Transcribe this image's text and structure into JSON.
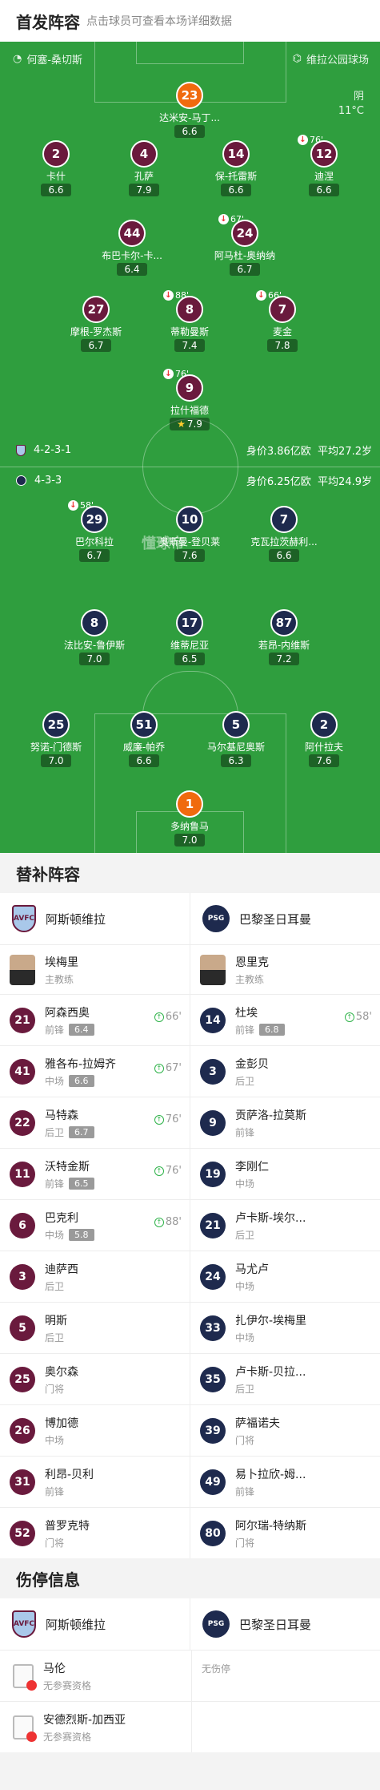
{
  "header": {
    "title": "首发阵容",
    "hint": "点击球员可查看本场详细数据"
  },
  "pitch_top": {
    "referee": "何塞-桑切斯",
    "stadium": "维拉公园球场",
    "weather": "阴",
    "temperature": "11°C",
    "watermark": "懂球帝"
  },
  "home": {
    "formation": "4-2-3-1",
    "value": "身价3.86亿欧",
    "age": "平均27.2岁"
  },
  "away": {
    "formation": "4-3-3",
    "value": "身价6.25亿欧",
    "age": "平均24.9岁"
  },
  "home_players": [
    {
      "num": "23",
      "name": "达米安-马丁...",
      "rating": "6.6",
      "gk": true
    },
    {
      "num": "2",
      "name": "卡什",
      "rating": "6.6"
    },
    {
      "num": "4",
      "name": "孔萨",
      "rating": "7.9"
    },
    {
      "num": "14",
      "name": "保-托雷斯",
      "rating": "6.6"
    },
    {
      "num": "12",
      "name": "迪涅",
      "rating": "6.6",
      "sub": "76'"
    },
    {
      "num": "44",
      "name": "布巴卡尔-卡...",
      "rating": "6.4"
    },
    {
      "num": "24",
      "name": "阿马杜-奥纳纳",
      "rating": "6.7",
      "sub": "67'"
    },
    {
      "num": "27",
      "name": "摩根-罗杰斯",
      "rating": "6.7"
    },
    {
      "num": "8",
      "name": "蒂勒曼斯",
      "rating": "7.4",
      "sub": "88'"
    },
    {
      "num": "7",
      "name": "麦金",
      "rating": "7.8",
      "sub": "66'"
    },
    {
      "num": "9",
      "name": "拉什福德",
      "rating": "7.9",
      "sub": "76'",
      "star": true
    }
  ],
  "away_players": [
    {
      "num": "29",
      "name": "巴尔科拉",
      "rating": "6.7",
      "sub": "58'"
    },
    {
      "num": "10",
      "name": "奥斯曼-登贝莱",
      "rating": "7.6"
    },
    {
      "num": "7",
      "name": "克瓦拉茨赫利...",
      "rating": "6.6"
    },
    {
      "num": "8",
      "name": "法比安-鲁伊斯",
      "rating": "7.0"
    },
    {
      "num": "17",
      "name": "维蒂尼亚",
      "rating": "6.5"
    },
    {
      "num": "87",
      "name": "若昂-内维斯",
      "rating": "7.2"
    },
    {
      "num": "25",
      "name": "努诺-门德斯",
      "rating": "7.0"
    },
    {
      "num": "51",
      "name": "威廉-帕乔",
      "rating": "6.6"
    },
    {
      "num": "5",
      "name": "马尔基尼奥斯",
      "rating": "6.3"
    },
    {
      "num": "2",
      "name": "阿什拉夫",
      "rating": "7.6"
    },
    {
      "num": "1",
      "name": "多纳鲁马",
      "rating": "7.0",
      "gk": true
    }
  ],
  "subs": {
    "title": "替补阵容",
    "home_team": "阿斯顿维拉",
    "away_team": "巴黎圣日耳曼",
    "home_coach": {
      "name": "埃梅里",
      "role": "主教练"
    },
    "away_coach": {
      "name": "恩里克",
      "role": "主教练"
    },
    "rows": [
      [
        {
          "num": "21",
          "name": "阿森西奥",
          "pos": "前锋",
          "rating": "6.4",
          "time": "66'"
        },
        {
          "num": "14",
          "name": "杜埃",
          "pos": "前锋",
          "rating": "6.8",
          "time": "58'"
        }
      ],
      [
        {
          "num": "41",
          "name": "雅各布-拉姆齐",
          "pos": "中场",
          "rating": "6.6",
          "time": "67'"
        },
        {
          "num": "3",
          "name": "金彭贝",
          "pos": "后卫"
        }
      ],
      [
        {
          "num": "22",
          "name": "马特森",
          "pos": "后卫",
          "rating": "6.7",
          "time": "76'"
        },
        {
          "num": "9",
          "name": "贡萨洛-拉莫斯",
          "pos": "前锋"
        }
      ],
      [
        {
          "num": "11",
          "name": "沃特金斯",
          "pos": "前锋",
          "rating": "6.5",
          "time": "76'"
        },
        {
          "num": "19",
          "name": "李刚仁",
          "pos": "中场"
        }
      ],
      [
        {
          "num": "6",
          "name": "巴克利",
          "pos": "中场",
          "rating": "5.8",
          "time": "88'"
        },
        {
          "num": "21",
          "name": "卢卡斯-埃尔...",
          "pos": "后卫"
        }
      ],
      [
        {
          "num": "3",
          "name": "迪萨西",
          "pos": "后卫"
        },
        {
          "num": "24",
          "name": "马尤卢",
          "pos": "中场"
        }
      ],
      [
        {
          "num": "5",
          "name": "明斯",
          "pos": "后卫"
        },
        {
          "num": "33",
          "name": "扎伊尔-埃梅里",
          "pos": "中场"
        }
      ],
      [
        {
          "num": "25",
          "name": "奥尔森",
          "pos": "门将"
        },
        {
          "num": "35",
          "name": "卢卡斯-贝拉...",
          "pos": "后卫"
        }
      ],
      [
        {
          "num": "26",
          "name": "博加德",
          "pos": "中场"
        },
        {
          "num": "39",
          "name": "萨福诺夫",
          "pos": "门将"
        }
      ],
      [
        {
          "num": "31",
          "name": "利昂-贝利",
          "pos": "前锋"
        },
        {
          "num": "49",
          "name": "易卜拉欣-姆...",
          "pos": "前锋"
        }
      ],
      [
        {
          "num": "52",
          "name": "普罗克特",
          "pos": "门将"
        },
        {
          "num": "80",
          "name": "阿尔瑞-特纳斯",
          "pos": "门将"
        }
      ]
    ]
  },
  "injuries": {
    "title": "伤停信息",
    "home_team": "阿斯顿维拉",
    "away_team": "巴黎圣日耳曼",
    "home": [
      {
        "name": "马伦",
        "status": "无参赛资格"
      },
      {
        "name": "安德烈斯-加西亚",
        "status": "无参赛资格"
      }
    ],
    "away_empty": "无伤停"
  },
  "crest_text": {
    "villa": "AVFC",
    "psg": "PSG"
  }
}
